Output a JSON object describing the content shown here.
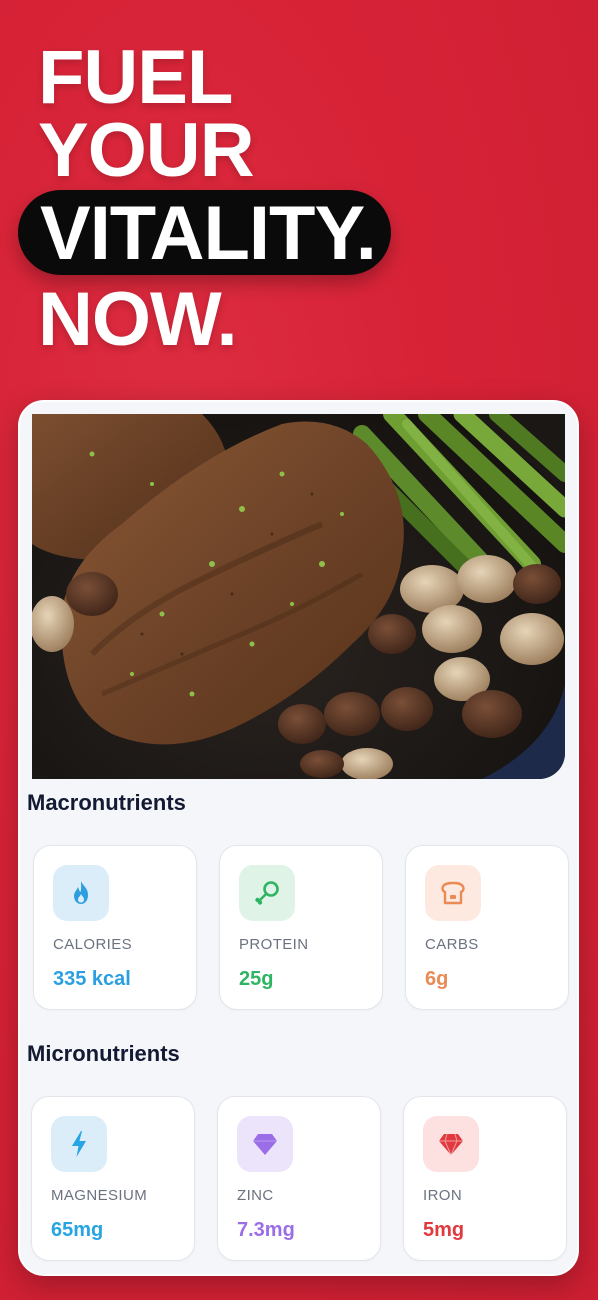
{
  "hero": {
    "line1": "FUEL",
    "line2": "YOUR",
    "line3": "VITALITY.",
    "line4": "NOW."
  },
  "macro": {
    "title": "Macronutrients",
    "items": [
      {
        "label": "CALORIES",
        "value": "335 kcal",
        "icon": "flame-icon",
        "color": "#2b9fe0",
        "bg": "#dcedfa"
      },
      {
        "label": "PROTEIN",
        "value": "25g",
        "icon": "drumstick-icon",
        "color": "#2fb463",
        "bg": "#dff4e7"
      },
      {
        "label": "CARBS",
        "value": "6g",
        "icon": "bread-icon",
        "color": "#ea8a55",
        "bg": "#fde9df"
      }
    ]
  },
  "micro": {
    "title": "Micronutrients",
    "items": [
      {
        "label": "MAGNESIUM",
        "value": "65mg",
        "icon": "lightning-icon",
        "color": "#27a4e2",
        "bg": "#dcedfa"
      },
      {
        "label": "ZINC",
        "value": "7.3mg",
        "icon": "diamond-icon",
        "color": "#9b6de6",
        "bg": "#ece4fb"
      },
      {
        "label": "IRON",
        "value": "5mg",
        "icon": "gem-icon",
        "color": "#e0393e",
        "bg": "#fde1e1"
      }
    ]
  }
}
